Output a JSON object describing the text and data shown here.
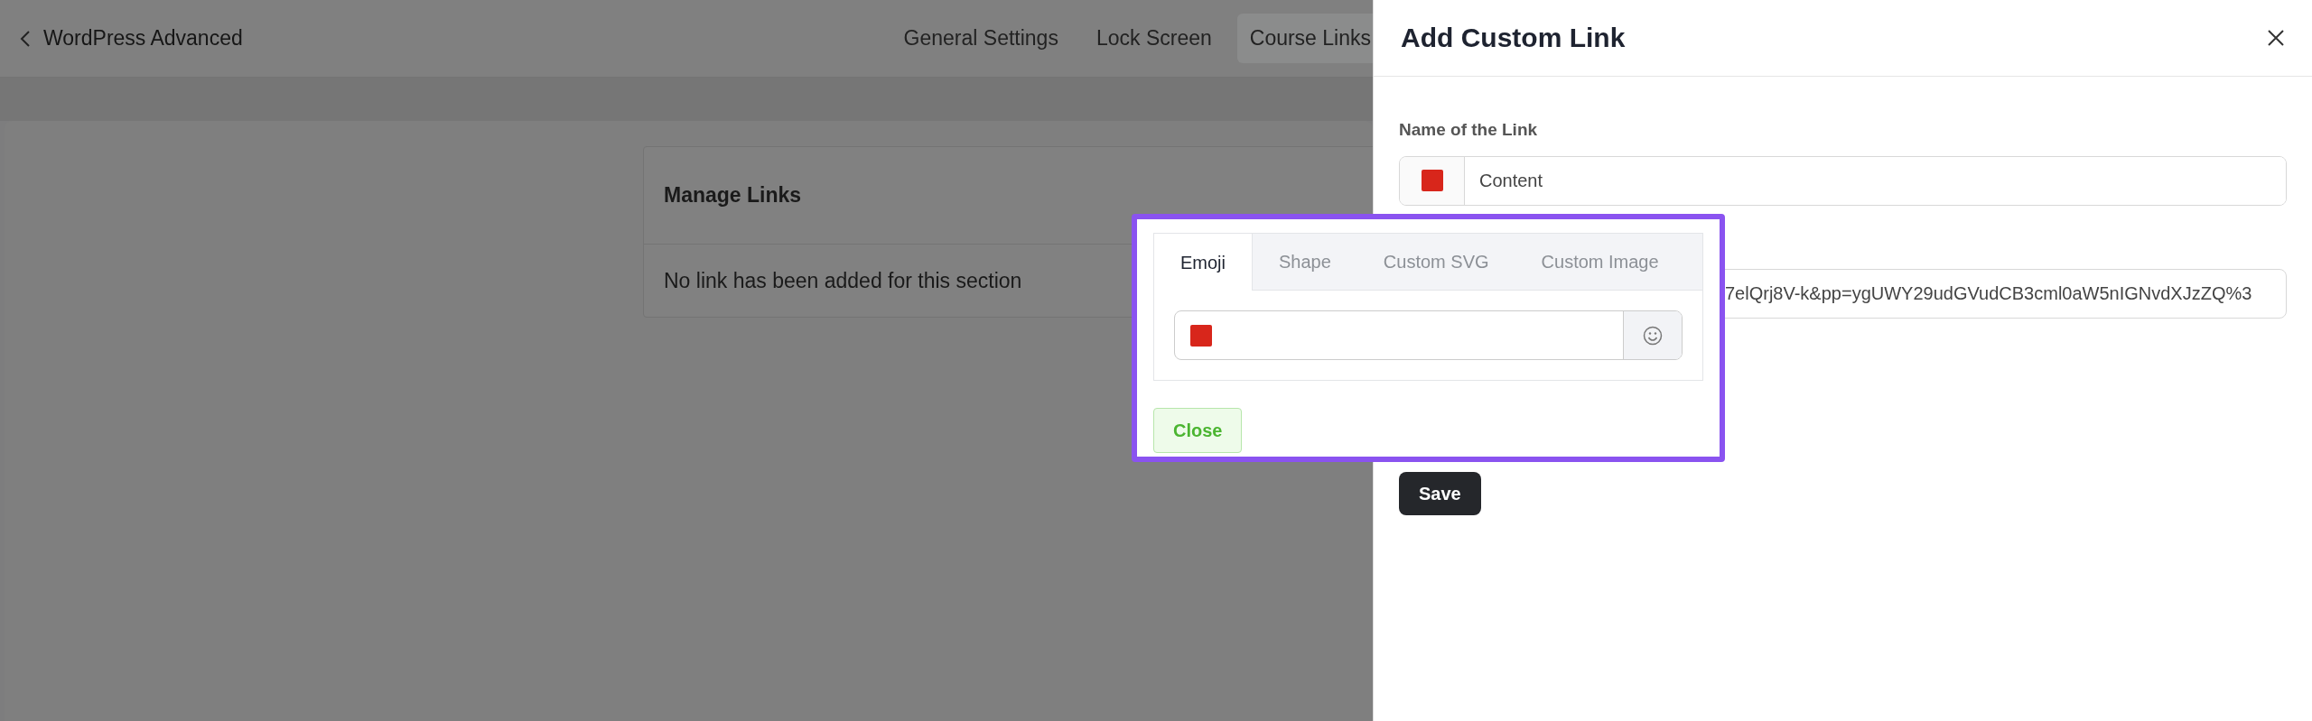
{
  "topbar": {
    "title": "WordPress Advanced",
    "tabs": [
      {
        "label": "General Settings",
        "selected": false
      },
      {
        "label": "Lock Screen",
        "selected": false
      },
      {
        "label": "Course Links",
        "selected": true
      }
    ]
  },
  "manage_links": {
    "title": "Manage Links",
    "empty_message": "No link has been added for this section"
  },
  "panel": {
    "title": "Add Custom Link",
    "fields": [
      {
        "kind": "emoji",
        "label": "Name of the Link",
        "value": "Content"
      },
      {
        "kind": "text",
        "value": "7elQrj8V-k&pp=ygUWY29udGVudCB3cml0aW5nIGNvdXJzZQ%3"
      }
    ],
    "save_button": "Save"
  },
  "icon_picker": {
    "tabs": [
      {
        "label": "Emoji",
        "selected": true
      },
      {
        "label": "Shape",
        "selected": false
      },
      {
        "label": "Custom SVG",
        "selected": false
      },
      {
        "label": "Custom Image",
        "selected": false
      }
    ],
    "close_button": "Close"
  }
}
